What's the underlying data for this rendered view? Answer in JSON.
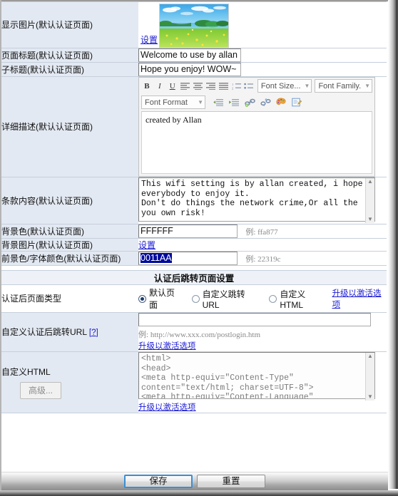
{
  "form": {
    "rows": [
      {
        "label": "显示图片(默认认证页面)",
        "link": "设置"
      },
      {
        "label": "页面标题(默认认证页面)",
        "value": "Welcome to use by allan w"
      },
      {
        "label": "子标题(默认认证页面)",
        "value": "Hope you enjoy! WOW~"
      },
      {
        "label": "详细描述(默认认证页面)",
        "value": "created by Allan"
      },
      {
        "label": "条款内容(默认认证页面)",
        "value": "This wifi setting is by allan created, i hope everybody to enjoy it.\nDon't do things the network crime,Or all the you own risk!"
      },
      {
        "label": "背景色(默认认证页面)",
        "value": "FFFFFF",
        "hint_prefix": "例:",
        "hint_value": "ffa877"
      },
      {
        "label": "背景图片(默认认证页面)",
        "link": "设置"
      },
      {
        "label": "前景色/字体颜色(默认认证页面)",
        "value": "0011AA",
        "hint_prefix": "例:",
        "hint_value": "22319c"
      }
    ]
  },
  "editor": {
    "toolbar_row1": [
      {
        "name": "bold-icon",
        "glyph": "B"
      },
      {
        "name": "italic-icon",
        "glyph": "I"
      },
      {
        "name": "underline-icon",
        "glyph": "U"
      },
      {
        "name": "align-left-icon",
        "glyph": "≡"
      },
      {
        "name": "align-center-icon",
        "glyph": "≡"
      },
      {
        "name": "align-right-icon",
        "glyph": "≡"
      },
      {
        "name": "align-justify-icon",
        "glyph": "≡"
      },
      {
        "name": "ordered-list-icon",
        "glyph": "⒈"
      },
      {
        "name": "unordered-list-icon",
        "glyph": "⁞"
      }
    ],
    "font_size_label": "Font Size...",
    "font_family_label": "Font Family.",
    "font_format_label": "Font Format",
    "toolbar_row2": [
      {
        "name": "outdent-icon",
        "glyph": "⇤"
      },
      {
        "name": "indent-icon",
        "glyph": "⇥"
      },
      {
        "name": "insert-link-icon",
        "glyph": "🔗"
      },
      {
        "name": "unlink-icon",
        "glyph": "⛓"
      },
      {
        "name": "text-color-icon",
        "glyph": "🎨"
      },
      {
        "name": "edit-source-icon",
        "glyph": "📝"
      }
    ],
    "body_text": "created by Allan"
  },
  "section": {
    "title": "认证后跳转页面设置",
    "page_type": {
      "label": "认证后页面类型",
      "options": [
        {
          "label": "默认页面",
          "selected": true
        },
        {
          "label": "自定义跳转URL",
          "selected": false
        },
        {
          "label": "自定义HTML",
          "selected": false
        }
      ],
      "upgrade_link": "升级以激活选项"
    },
    "custom_url": {
      "label": "自定义认证后跳转URL",
      "help_marker": "[?]",
      "value": "",
      "hint_prefix": "例:",
      "hint_value": "http://www.xxx.com/postlogin.htm",
      "upgrade_link": "升级以激活选项"
    },
    "custom_html": {
      "label": "自定义HTML",
      "advanced_button": "高级...",
      "value": "<html>\n<head>\n<meta http-equiv=\"Content-Type\" content=\"text/html; charset=UTF-8\">\n<meta http-equiv=\"Content-Language\" content=\"zh\">",
      "upgrade_link": "升级以激活选项"
    }
  },
  "footer": {
    "save_label": "保存",
    "reset_label": "重置"
  },
  "colors": {
    "label_bg": "#e3e9f2",
    "link": "#1a1ad2",
    "selection": "#000a9c",
    "section_bg": "#eef2f8"
  }
}
